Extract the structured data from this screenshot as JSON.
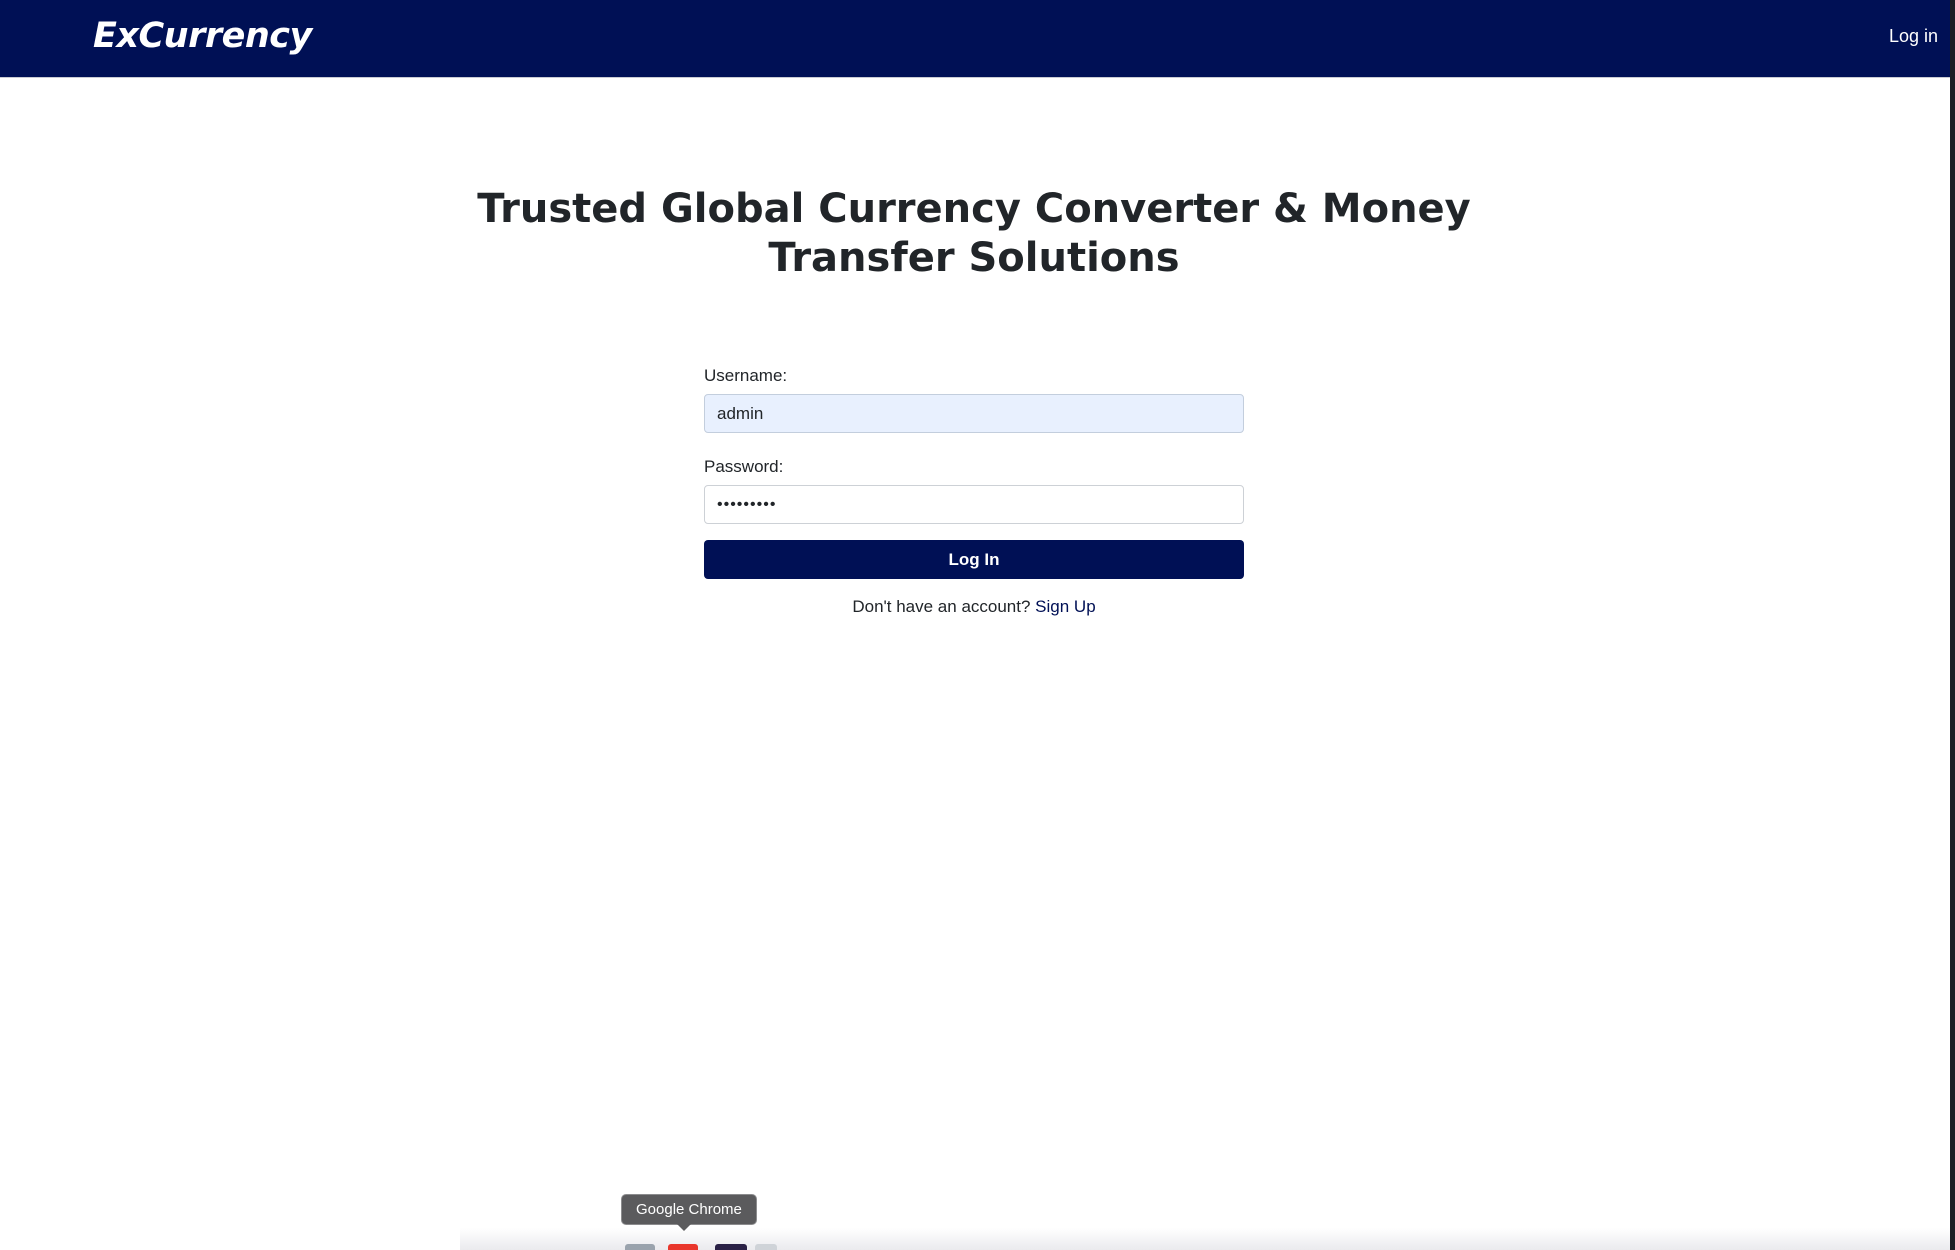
{
  "navbar": {
    "brand": "ExCurrency",
    "login_link": "Log in"
  },
  "hero": {
    "title": "Trusted Global Currency Converter & Money Transfer Solutions"
  },
  "login_form": {
    "username_label": "Username:",
    "username_value": "admin",
    "password_label": "Password:",
    "password_value": "•••••••••",
    "submit_label": "Log In",
    "signup_prompt": "Don't have an account?",
    "signup_link": "Sign Up"
  },
  "dock": {
    "tooltip": "Google Chrome",
    "icons": [
      "finder-icon",
      "chrome-icon",
      "app-icon",
      "app-icon-2"
    ]
  },
  "colors": {
    "navbar_bg": "#001055",
    "button_bg": "#001055",
    "autofill_bg": "#e8f0fe",
    "link": "#001055"
  }
}
